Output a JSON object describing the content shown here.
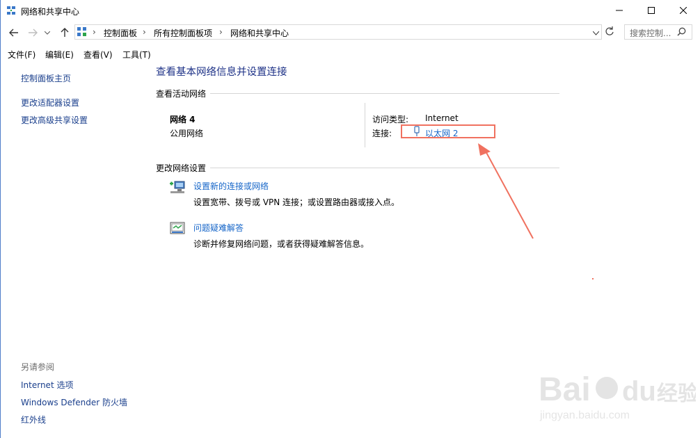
{
  "window": {
    "title": "网络和共享中心"
  },
  "breadcrumb": [
    "控制面板",
    "所有控制面板项",
    "网络和共享中心"
  ],
  "search": {
    "placeholder": "搜索控制..."
  },
  "menu": [
    "文件(F)",
    "编辑(E)",
    "查看(V)",
    "工具(T)"
  ],
  "sidebar": {
    "links": [
      "控制面板主页",
      "更改适配器设置",
      "更改高级共享设置"
    ],
    "see_also_title": "另请参阅",
    "see_also": [
      "Internet 选项",
      "Windows Defender 防火墙",
      "红外线"
    ]
  },
  "main": {
    "title": "查看基本网络信息并设置连接",
    "active_section": "查看活动网络",
    "network": {
      "name": "网络 4",
      "type": "公用网络",
      "access_label": "访问类型:",
      "access_value": "Internet",
      "conn_label": "连接:",
      "conn_value": "以太网 2"
    },
    "change_section": "更改网络设置",
    "tasks": [
      {
        "title": "设置新的连接或网络",
        "desc": "设置宽带、拨号或 VPN 连接；或设置路由器或接入点。",
        "icon": "new-connection-icon"
      },
      {
        "title": "问题疑难解答",
        "desc": "诊断并修复网络问题，或者获得疑难解答信息。",
        "icon": "troubleshoot-icon"
      }
    ]
  },
  "colors": {
    "link": "#1565c8",
    "title": "#1e3287",
    "annotation": "#f0715f"
  }
}
